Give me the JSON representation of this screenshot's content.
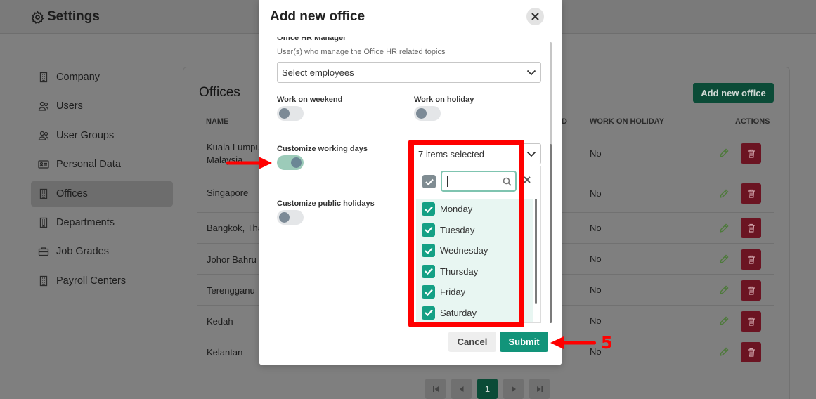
{
  "header": {
    "title": "Settings",
    "icon": "gear-icon"
  },
  "sidebar": {
    "items": [
      {
        "label": "Company",
        "icon": "building-icon"
      },
      {
        "label": "Users",
        "icon": "users-icon"
      },
      {
        "label": "User Groups",
        "icon": "user-groups-icon"
      },
      {
        "label": "Personal Data",
        "icon": "id-card-icon"
      },
      {
        "label": "Offices",
        "icon": "building-icon",
        "active": true
      },
      {
        "label": "Departments",
        "icon": "building-icon"
      },
      {
        "label": "Job Grades",
        "icon": "briefcase-icon"
      },
      {
        "label": "Payroll Centers",
        "icon": "building-icon"
      }
    ]
  },
  "offices": {
    "title": "Offices",
    "add_button": "Add new office",
    "columns": {
      "name": "NAME",
      "work_on_weekend_partial": "D",
      "work_on_holiday": "WORK ON HOLIDAY",
      "actions": "ACTIONS"
    },
    "rows": [
      {
        "name_line1": "Kuala Lumpur,",
        "name_line2": "Malaysia",
        "work_on_holiday": "No"
      },
      {
        "name_line1": "Singapore",
        "name_line2": "",
        "work_on_holiday": "No"
      },
      {
        "name_line1": "Bangkok, Tha",
        "name_line2": "",
        "work_on_holiday": "No"
      },
      {
        "name_line1": "Johor Bahru",
        "name_line2": "",
        "work_on_holiday": "No"
      },
      {
        "name_line1": "Terengganu",
        "name_line2": "",
        "work_on_holiday": "No"
      },
      {
        "name_line1": "Kedah",
        "name_line2": "",
        "work_on_holiday": "No"
      },
      {
        "name_line1": "Kelantan",
        "name_line2": "",
        "work_on_holiday": "No"
      }
    ],
    "pagination": {
      "current": "1"
    }
  },
  "modal": {
    "title": "Add new office",
    "hr_manager_label": "Office HR Manager",
    "hr_manager_hint": "User(s) who manage the Office HR related topics",
    "employees_placeholder": "Select employees",
    "work_on_weekend": {
      "label": "Work on weekend",
      "on": false
    },
    "work_on_holiday": {
      "label": "Work on holiday",
      "on": false
    },
    "customize_working_days": {
      "label": "Customize working days",
      "on": true
    },
    "customize_public_holidays": {
      "label": "Customize public holidays",
      "on": false
    },
    "working_days": {
      "summary": "7 items selected",
      "search_value": "",
      "options": [
        "Monday",
        "Tuesday",
        "Wednesday",
        "Thursday",
        "Friday",
        "Saturday"
      ]
    },
    "cancel_label": "Cancel",
    "submit_label": "Submit"
  },
  "annotation": {
    "step_number": "5",
    "color": "#ff0000"
  },
  "colors": {
    "primary": "#12947a",
    "danger": "#c62a3f",
    "annotation": "#ff0000"
  }
}
